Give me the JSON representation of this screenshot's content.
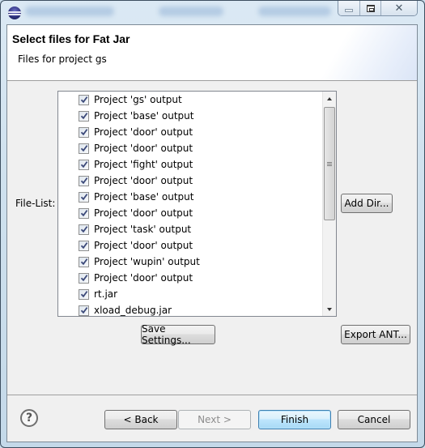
{
  "window": {
    "app_icon": "eclipse-icon",
    "controls": {
      "minimize_icon": "minimize-icon",
      "maximize_icon": "maximize-icon",
      "close_icon": "close-icon"
    }
  },
  "header": {
    "title": "Select files for Fat Jar",
    "subtitle": "Files for project gs"
  },
  "file_list": {
    "label": "File-List:",
    "items": [
      {
        "label": "Project 'gs' output",
        "checked": true
      },
      {
        "label": "Project 'base' output",
        "checked": true
      },
      {
        "label": "Project 'door' output",
        "checked": true
      },
      {
        "label": "Project 'door' output",
        "checked": true
      },
      {
        "label": "Project 'fight' output",
        "checked": true
      },
      {
        "label": "Project 'door' output",
        "checked": true
      },
      {
        "label": "Project 'base' output",
        "checked": true
      },
      {
        "label": "Project 'door' output",
        "checked": true
      },
      {
        "label": "Project 'task' output",
        "checked": true
      },
      {
        "label": "Project 'door' output",
        "checked": true
      },
      {
        "label": "Project 'wupin' output",
        "checked": true
      },
      {
        "label": "Project 'door' output",
        "checked": true
      },
      {
        "label": "rt.jar",
        "checked": true
      },
      {
        "label": "xload_debug.jar",
        "checked": true
      }
    ],
    "scroll_position": 0.0
  },
  "buttons": {
    "add_dir": "Add Dir...",
    "save_settings": "Save Settings...",
    "export_ant": "Export ANT...",
    "back": "< Back",
    "next": "Next >",
    "finish": "Finish",
    "cancel": "Cancel",
    "help_icon": "?"
  }
}
